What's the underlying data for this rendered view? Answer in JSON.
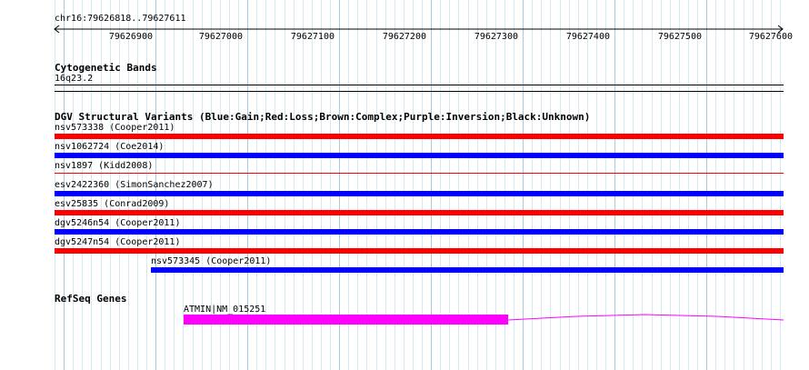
{
  "location": "chr16:79626818..79627611",
  "ruler": {
    "ticks": [
      "79626900",
      "79627000",
      "79627100",
      "79627200",
      "79627300",
      "79627400",
      "79627500",
      "79627600"
    ]
  },
  "tracks": {
    "cytoband": {
      "title": "Cytogenetic Bands",
      "band": "16q23.2"
    },
    "dgv": {
      "title": "DGV Structural Variants (Blue:Gain;Red:Loss;Brown:Complex;Purple:Inversion;Black:Unknown)",
      "features": [
        {
          "label": "nsv573338 (Cooper2011)",
          "type": "loss",
          "color": "#ff0000"
        },
        {
          "label": "nsv1062724 (Coe2014)",
          "type": "gain",
          "color": "#0000ff"
        },
        {
          "label": "nsv1897 (Kidd2008)",
          "type": "loss",
          "color": "#ff0000"
        },
        {
          "label": "esv2422360 (SimonSanchez2007)",
          "type": "gain",
          "color": "#0000ff"
        },
        {
          "label": "esv25835 (Conrad2009)",
          "type": "loss",
          "color": "#ff0000"
        },
        {
          "label": "dgv5246n54 (Cooper2011)",
          "type": "gain",
          "color": "#0000ff"
        },
        {
          "label": "dgv5247n54 (Cooper2011)",
          "type": "loss",
          "color": "#ff0000"
        },
        {
          "label": "nsv573345 (Cooper2011)",
          "type": "gain",
          "color": "#0000ff"
        }
      ]
    },
    "refseq": {
      "title": "RefSeq Genes",
      "gene": {
        "label": "ATMIN|NM_015251",
        "color": "#ff00ff"
      }
    }
  }
}
